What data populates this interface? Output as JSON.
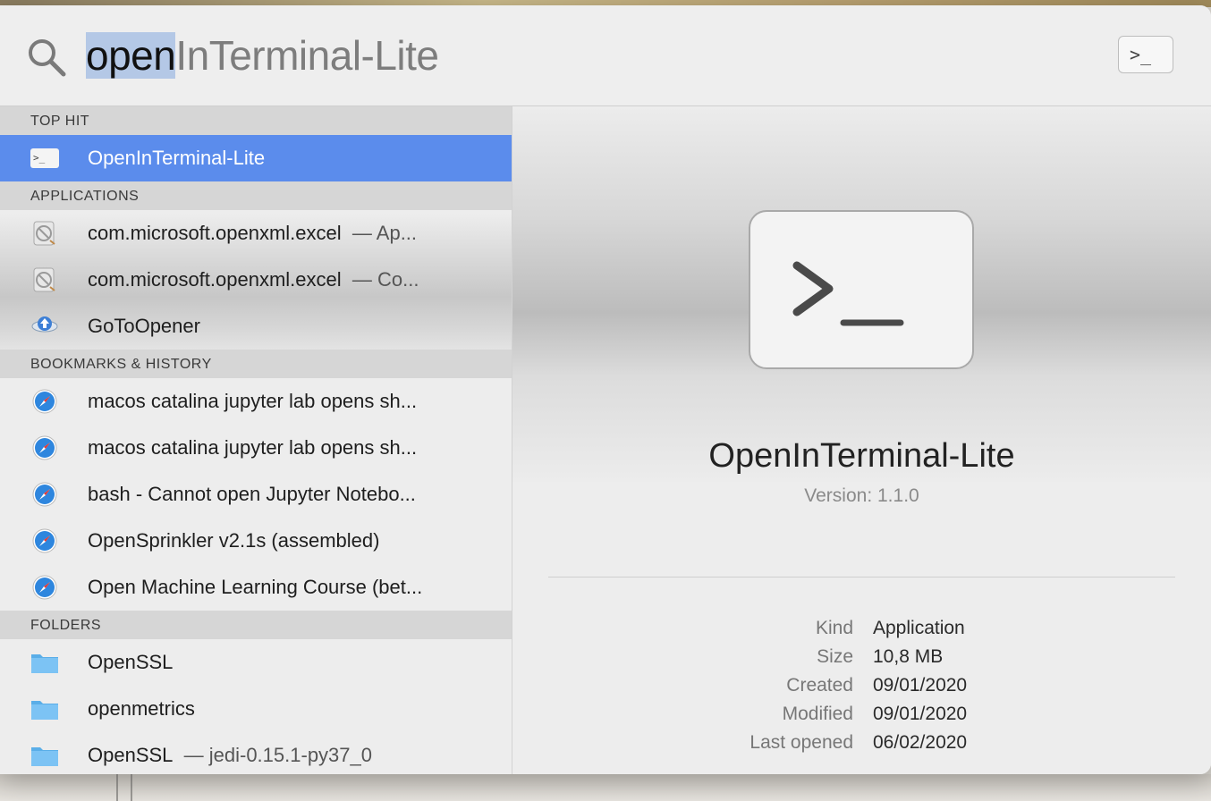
{
  "search": {
    "typed": "open",
    "completion": "InTerminal-Lite",
    "terminal_button_label": ">_"
  },
  "results": {
    "top_hit": {
      "header": "TOP HIT",
      "items": [
        {
          "label": "OpenInTerminal-Lite",
          "icon": "terminal-app-icon"
        }
      ]
    },
    "applications": {
      "header": "APPLICATIONS",
      "items": [
        {
          "label": "com.microsoft.openxml.excel",
          "sub": "— Ap...",
          "icon": "prohibited-app-icon"
        },
        {
          "label": "com.microsoft.openxml.excel",
          "sub": "— Co...",
          "icon": "prohibited-app-icon"
        },
        {
          "label": "GoToOpener",
          "sub": "",
          "icon": "gotoopener-icon"
        }
      ]
    },
    "bookmarks": {
      "header": "BOOKMARKS & HISTORY",
      "items": [
        {
          "label": "macos catalina jupyter lab opens sh...",
          "icon": "safari-icon"
        },
        {
          "label": "macos catalina jupyter lab opens sh...",
          "icon": "safari-icon"
        },
        {
          "label": "bash - Cannot open Jupyter Notebo...",
          "icon": "safari-icon"
        },
        {
          "label": "OpenSprinkler v2.1s (assembled)",
          "icon": "safari-icon"
        },
        {
          "label": "Open Machine Learning Course (bet...",
          "icon": "safari-icon"
        }
      ]
    },
    "folders": {
      "header": "FOLDERS",
      "items": [
        {
          "label": "OpenSSL",
          "sub": "",
          "icon": "folder-icon"
        },
        {
          "label": "openmetrics",
          "sub": "",
          "icon": "folder-icon"
        },
        {
          "label": "OpenSSL",
          "sub": "— jedi-0.15.1-py37_0",
          "icon": "folder-icon"
        }
      ]
    }
  },
  "preview": {
    "app_name": "OpenInTerminal-Lite",
    "version": "Version: 1.1.0",
    "meta": [
      {
        "key": "Kind",
        "value": "Application"
      },
      {
        "key": "Size",
        "value": "10,8 MB"
      },
      {
        "key": "Created",
        "value": "09/01/2020"
      },
      {
        "key": "Modified",
        "value": "09/01/2020"
      },
      {
        "key": "Last opened",
        "value": "06/02/2020"
      }
    ]
  },
  "colors": {
    "selection": "#5b8cec",
    "text_highlight": "#b4c8e6",
    "folder": "#66b4ee"
  }
}
